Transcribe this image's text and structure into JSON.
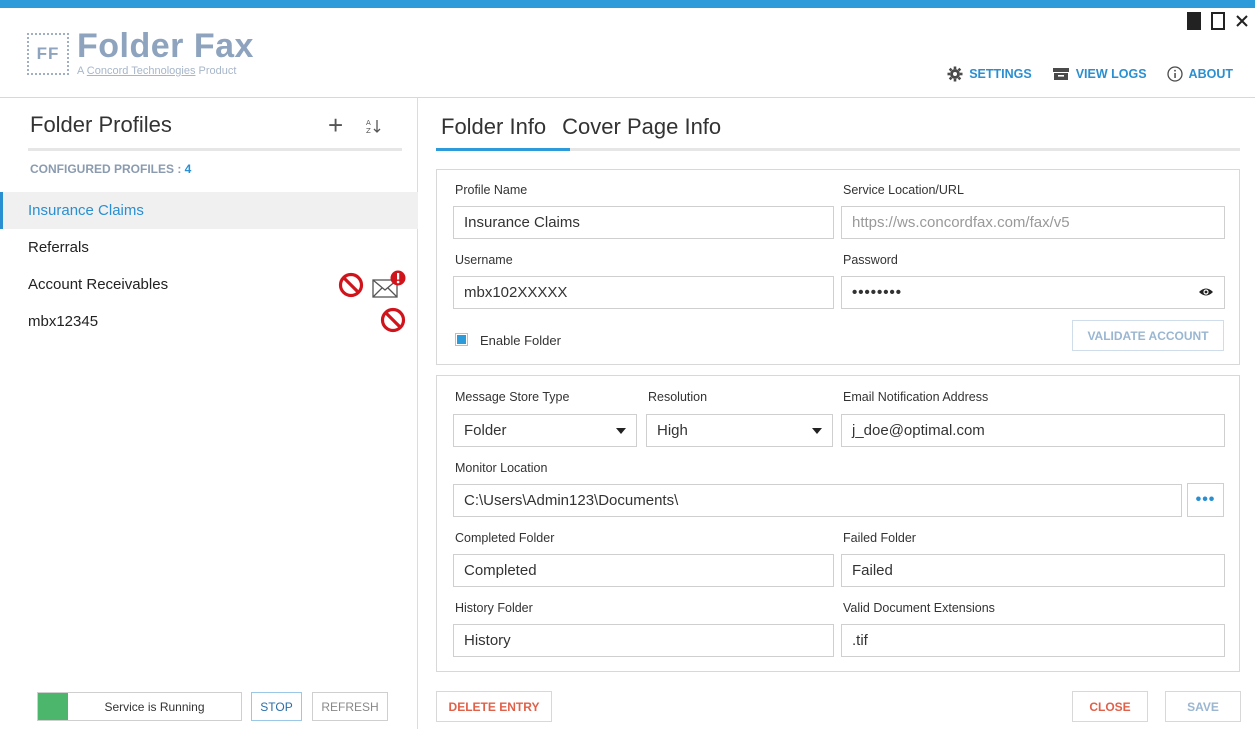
{
  "app": {
    "logo_mark": "FF",
    "title": "Folder Fax",
    "subtitle_prefix": "A ",
    "subtitle_link": "Concord Technologies",
    "subtitle_suffix": " Product"
  },
  "header": {
    "settings_label": "SETTINGS",
    "view_logs_label": "VIEW LOGS",
    "about_label": "ABOUT"
  },
  "sidebar": {
    "title": "Folder Profiles",
    "add_symbol": "+",
    "sort_symbol": "⇅",
    "configured_label": "CONFIGURED PROFILES : ",
    "configured_count": "4",
    "profiles": [
      {
        "label": "Insurance Claims"
      },
      {
        "label": "Referrals"
      },
      {
        "label": "Account Receivables"
      },
      {
        "label": "mbx12345"
      }
    ],
    "service_status": "Service is Running",
    "stop_label": "STOP",
    "refresh_label": "REFRESH"
  },
  "tabs": [
    {
      "label": "Folder Info"
    },
    {
      "label": "Cover Page Info"
    }
  ],
  "form": {
    "profile_name_label": "Profile Name",
    "profile_name_value": "Insurance Claims",
    "service_url_label": "Service Location/URL",
    "service_url_value": "https://ws.concordfax.com/fax/v5",
    "username_label": "Username",
    "username_value": "mbx102XXXXX",
    "password_label": "Password",
    "password_value": "••••••••",
    "enable_folder_label": "Enable Folder",
    "validate_label": "VALIDATE ACCOUNT",
    "store_type_label": "Message Store Type",
    "store_type_value": "Folder",
    "resolution_label": "Resolution",
    "resolution_value": "High",
    "email_label": "Email Notification Address",
    "email_value": "j_doe@optimal.com",
    "monitor_label": "Monitor Location",
    "monitor_value": "C:\\Users\\Admin123\\Documents\\",
    "browse_label": "•••",
    "completed_label": "Completed Folder",
    "completed_value": "Completed",
    "failed_label": "Failed Folder",
    "failed_value": "Failed",
    "history_label": "History Folder",
    "history_value": "History",
    "extensions_label": "Valid Document Extensions",
    "extensions_value": ".tif"
  },
  "footer": {
    "delete_label": "DELETE ENTRY",
    "close_label": "CLOSE",
    "save_label": "SAVE"
  },
  "colors": {
    "accent": "#2d9ad9",
    "danger": "#e0614a",
    "running": "#4cb76c",
    "no_icon": "#d0141c"
  }
}
